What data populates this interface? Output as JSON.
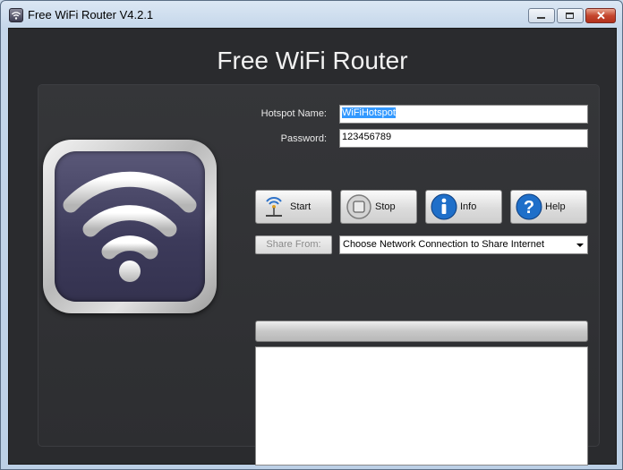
{
  "window": {
    "title": "Free WiFi Router V4.2.1"
  },
  "header": {
    "title": "Free WiFi Router"
  },
  "form": {
    "hotspot_label": "Hotspot Name:",
    "hotspot_value": "WiFiHotspot",
    "password_label": "Password:",
    "password_value": "123456789"
  },
  "buttons": {
    "start": "Start",
    "stop": "Stop",
    "info": "Info",
    "help": "Help"
  },
  "share": {
    "button_label": "Share From:",
    "selected": "Choose Network Connection to Share Internet"
  },
  "progress": {
    "value": 0
  },
  "colors": {
    "background": "#2a2b2e",
    "info_icon": "#1f6fc9",
    "help_icon": "#1f6fc9",
    "selection": "#3399ff"
  },
  "icons": {
    "app": "wifi-icon",
    "start": "wifi-antenna-icon",
    "stop": "stop-icon",
    "info": "info-icon",
    "help": "help-icon"
  }
}
